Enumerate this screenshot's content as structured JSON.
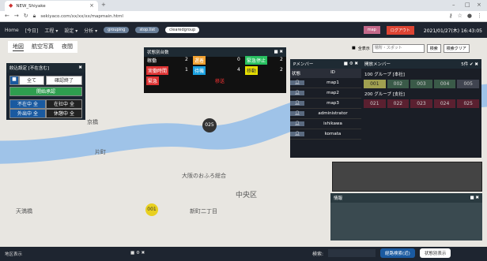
{
  "browser": {
    "tab_title": "NEW_Shiyake",
    "url": "sekiyaco.com/xx/xx/xx/mapmain.html",
    "new_tab": "+",
    "close_tab": "×"
  },
  "appnav": {
    "items": [
      "Home",
      "[今日]",
      "工程 ▾",
      "設定 ▾",
      "分析 ▾"
    ],
    "pills": [
      "grouping",
      "stop.list",
      "clearedgroup"
    ],
    "btn_left": "map",
    "btn_right": "ログアウト",
    "datetime": "2021/01/27(木) 16:43:05"
  },
  "map_tabs": [
    "地図",
    "航空写真",
    "夜間"
  ],
  "search": {
    "checkbox_label": "全表示",
    "placeholder": "場所・スポット",
    "btn1": "検索",
    "btn2": "検索クリア"
  },
  "map_labels": [
    "中央区",
    "新町二丁目",
    "大阪のおふろ総合",
    "京橋",
    "片町",
    "天満橋"
  ],
  "markers": {
    "m025": "025",
    "m001": "001"
  },
  "filter_panel": {
    "title": "絞込設定 [不在含む]",
    "btn_all": "全て",
    "btn_checked": "確認終了",
    "btn_green": "開始承認",
    "row1_left": "不在中 全",
    "row1_right": "在社中 全",
    "row2_left": "外出中 全",
    "row2_right": "休憩中 全"
  },
  "status_panel": {
    "title": "状態別台数",
    "rows": [
      {
        "label": "稼働",
        "count": "2",
        "badge": "遅着",
        "badge_color": "#f0a030",
        "count2": "0",
        "badge2": "緊急停止",
        "badge2_color": "#28c060",
        "count3": "2"
      },
      {
        "label": "実働時間",
        "count": "1",
        "badge": "待機",
        "badge_color": "#1aa0e0",
        "count2": "4",
        "badge2": "移動",
        "badge2_color": "#e8e000",
        "count3": "2"
      },
      {
        "label": "緊急",
        "count": "",
        "badge": "",
        "badge_color": "",
        "count2": "",
        "badge2": "",
        "badge2_color": "",
        "count3": ""
      }
    ],
    "alert_label": "移送"
  },
  "member_panel": {
    "title": "Pメンバー",
    "col_state": "状態",
    "col_id": "ID",
    "members": [
      "map1",
      "map2",
      "map3",
      "administrator",
      "ishikawa",
      "komata"
    ]
  },
  "group_panel": {
    "title": "開放メンバー",
    "count_label": "5件",
    "group1": "100 グループ [本社]",
    "group1_cells": [
      "001",
      "002",
      "003",
      "004",
      "005"
    ],
    "group2": "200 グループ [支社]",
    "group2_cells": [
      "021",
      "022",
      "023",
      "024",
      "025"
    ]
  },
  "info_panel": {
    "title": "情報"
  },
  "bottom": {
    "left_title": "地区表示",
    "search_label": "検索:",
    "btn1": "経路検索(近)",
    "btn2": "状態別表示"
  },
  "colors": {
    "nav_bg": "#1f2530",
    "panel_bg": "#1a1e26",
    "green": "#2e9e4f",
    "blue": "#1a5aa0"
  }
}
